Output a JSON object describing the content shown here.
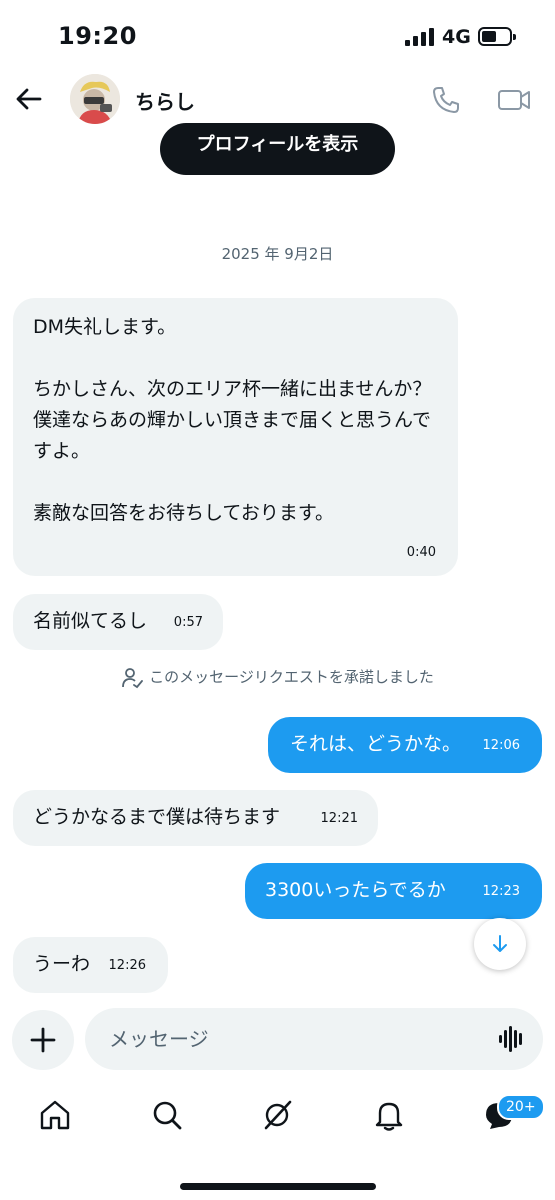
{
  "status_bar": {
    "time": "19:20",
    "network": "4G"
  },
  "header": {
    "contact_name": "ちらし"
  },
  "profile_button_label": "プロフィールを表示",
  "date_label": "2025 年 9月2日",
  "messages": [
    {
      "direction": "in",
      "text": "DM失礼します。\n\nちかしさん、次のエリア杯一緒に出ませんか？\n僕達ならあの輝かしい頂きまで届くと思うんですよ。\n\n素敵な回答をお待ちしております。",
      "time": "0:40"
    },
    {
      "direction": "in",
      "text": "名前似てるし",
      "time": "0:57"
    },
    {
      "direction": "out",
      "text": "それは、どうかな。",
      "time": "12:06"
    },
    {
      "direction": "in",
      "text": "どうかなるまで僕は待ちます",
      "time": "12:21"
    },
    {
      "direction": "out",
      "text": "3300いったらでるか",
      "time": "12:23"
    },
    {
      "direction": "in",
      "text": "うーわ",
      "time": "12:26"
    }
  ],
  "request_note": "このメッセージリクエストを承諾しました",
  "composer": {
    "placeholder": "メッセージ"
  },
  "nav": {
    "items": [
      "home-icon",
      "search-icon",
      "grok-icon",
      "notifications-icon",
      "messages-icon"
    ],
    "messages_badge": "20+"
  },
  "colors": {
    "accent": "#1d9bf0",
    "incoming_bubble": "#eff3f4",
    "text": "#0f1419",
    "muted": "#536471"
  }
}
